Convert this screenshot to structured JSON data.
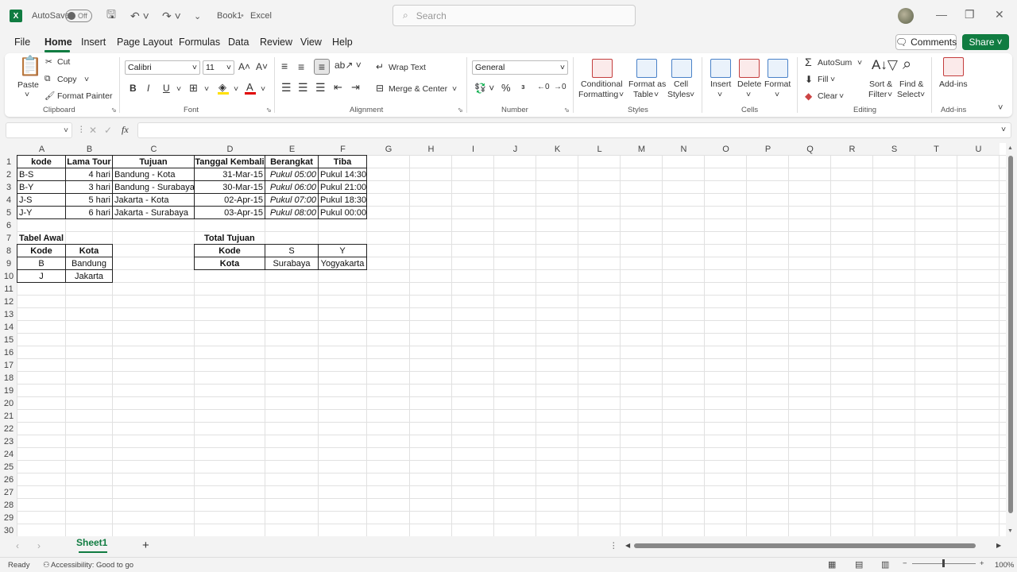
{
  "titlebar": {
    "autosave_label": "AutoSave",
    "autosave_state": "Off",
    "doc_name": "Book1",
    "app_name": "Excel",
    "search_placeholder": "Search"
  },
  "menu": {
    "items": [
      "File",
      "Home",
      "Insert",
      "Page Layout",
      "Formulas",
      "Data",
      "Review",
      "View",
      "Help"
    ],
    "active": "Home",
    "comments_label": "Comments",
    "share_label": "Share"
  },
  "ribbon": {
    "clipboard": {
      "paste": "Paste",
      "cut": "Cut",
      "copy": "Copy",
      "format_painter": "Format Painter",
      "label": "Clipboard"
    },
    "font": {
      "name": "Calibri",
      "size": "11",
      "bold": "B",
      "italic": "I",
      "underline": "U",
      "label": "Font"
    },
    "alignment": {
      "wrap_text": "Wrap Text",
      "merge_center": "Merge & Center",
      "label": "Alignment"
    },
    "number": {
      "format": "General",
      "label": "Number"
    },
    "styles": {
      "conditional": "Conditional",
      "conditional2": "Formatting",
      "format_as": "Format as",
      "format_as2": "Table",
      "cell": "Cell",
      "cell2": "Styles",
      "label": "Styles"
    },
    "cells": {
      "insert": "Insert",
      "delete": "Delete",
      "format": "Format",
      "label": "Cells"
    },
    "editing": {
      "autosum": "AutoSum",
      "fill": "Fill",
      "clear": "Clear",
      "sort": "Sort &",
      "sort2": "Filter",
      "find": "Find &",
      "find2": "Select",
      "label": "Editing"
    },
    "addins": {
      "label_btn": "Add-ins",
      "label": "Add-ins"
    }
  },
  "formula_bar": {
    "fx": "fx",
    "value": ""
  },
  "columns": [
    "A",
    "B",
    "C",
    "D",
    "E",
    "F",
    "G",
    "H",
    "I",
    "J",
    "K",
    "L",
    "M",
    "N",
    "O",
    "P",
    "Q",
    "R",
    "S",
    "T",
    "U"
  ],
  "rows": [
    "1",
    "2",
    "3",
    "4",
    "5",
    "6",
    "7",
    "8",
    "9",
    "10",
    "11",
    "12",
    "13",
    "14",
    "15",
    "16",
    "17",
    "18",
    "19",
    "20",
    "21",
    "22",
    "23",
    "24",
    "25",
    "26",
    "27",
    "28",
    "29",
    "30"
  ],
  "sheet": {
    "main_headers": [
      "kode",
      "Lama Tour",
      "Tujuan",
      "Tanggal Kembali",
      "Berangkat",
      "Tiba"
    ],
    "main_rows": [
      [
        "B-S",
        "4 hari",
        "Bandung - Kota",
        "31-Mar-15",
        "Pukul 05:00",
        "Pukul 14:30"
      ],
      [
        "B-Y",
        "3 hari",
        "Bandung - Surabaya",
        "30-Mar-15",
        "Pukul 06:00",
        "Pukul 21:00"
      ],
      [
        "J-S",
        "5 hari",
        "Jakarta - Kota",
        "02-Apr-15",
        "Pukul 07:00",
        "Pukul 18:30"
      ],
      [
        "J-Y",
        "6 hari",
        "Jakarta - Surabaya",
        "03-Apr-15",
        "Pukul 08:00",
        "Pukul 00:00"
      ]
    ],
    "tabel_awal": {
      "title": "Tabel Awal",
      "headers": [
        "Kode",
        "Kota"
      ],
      "rows": [
        [
          "B",
          "Bandung"
        ],
        [
          "J",
          "Jakarta"
        ]
      ]
    },
    "total_tujuan": {
      "title": "Total Tujuan",
      "row1": [
        "Kode",
        "S",
        "Y"
      ],
      "row2": [
        "Kota",
        "Surabaya",
        "Yogyakarta"
      ]
    }
  },
  "sheet_tab": "Sheet1",
  "status": {
    "ready": "Ready",
    "accessibility": "Accessibility: Good to go",
    "zoom": "100%"
  },
  "colors": {
    "accent": "#107c41"
  }
}
